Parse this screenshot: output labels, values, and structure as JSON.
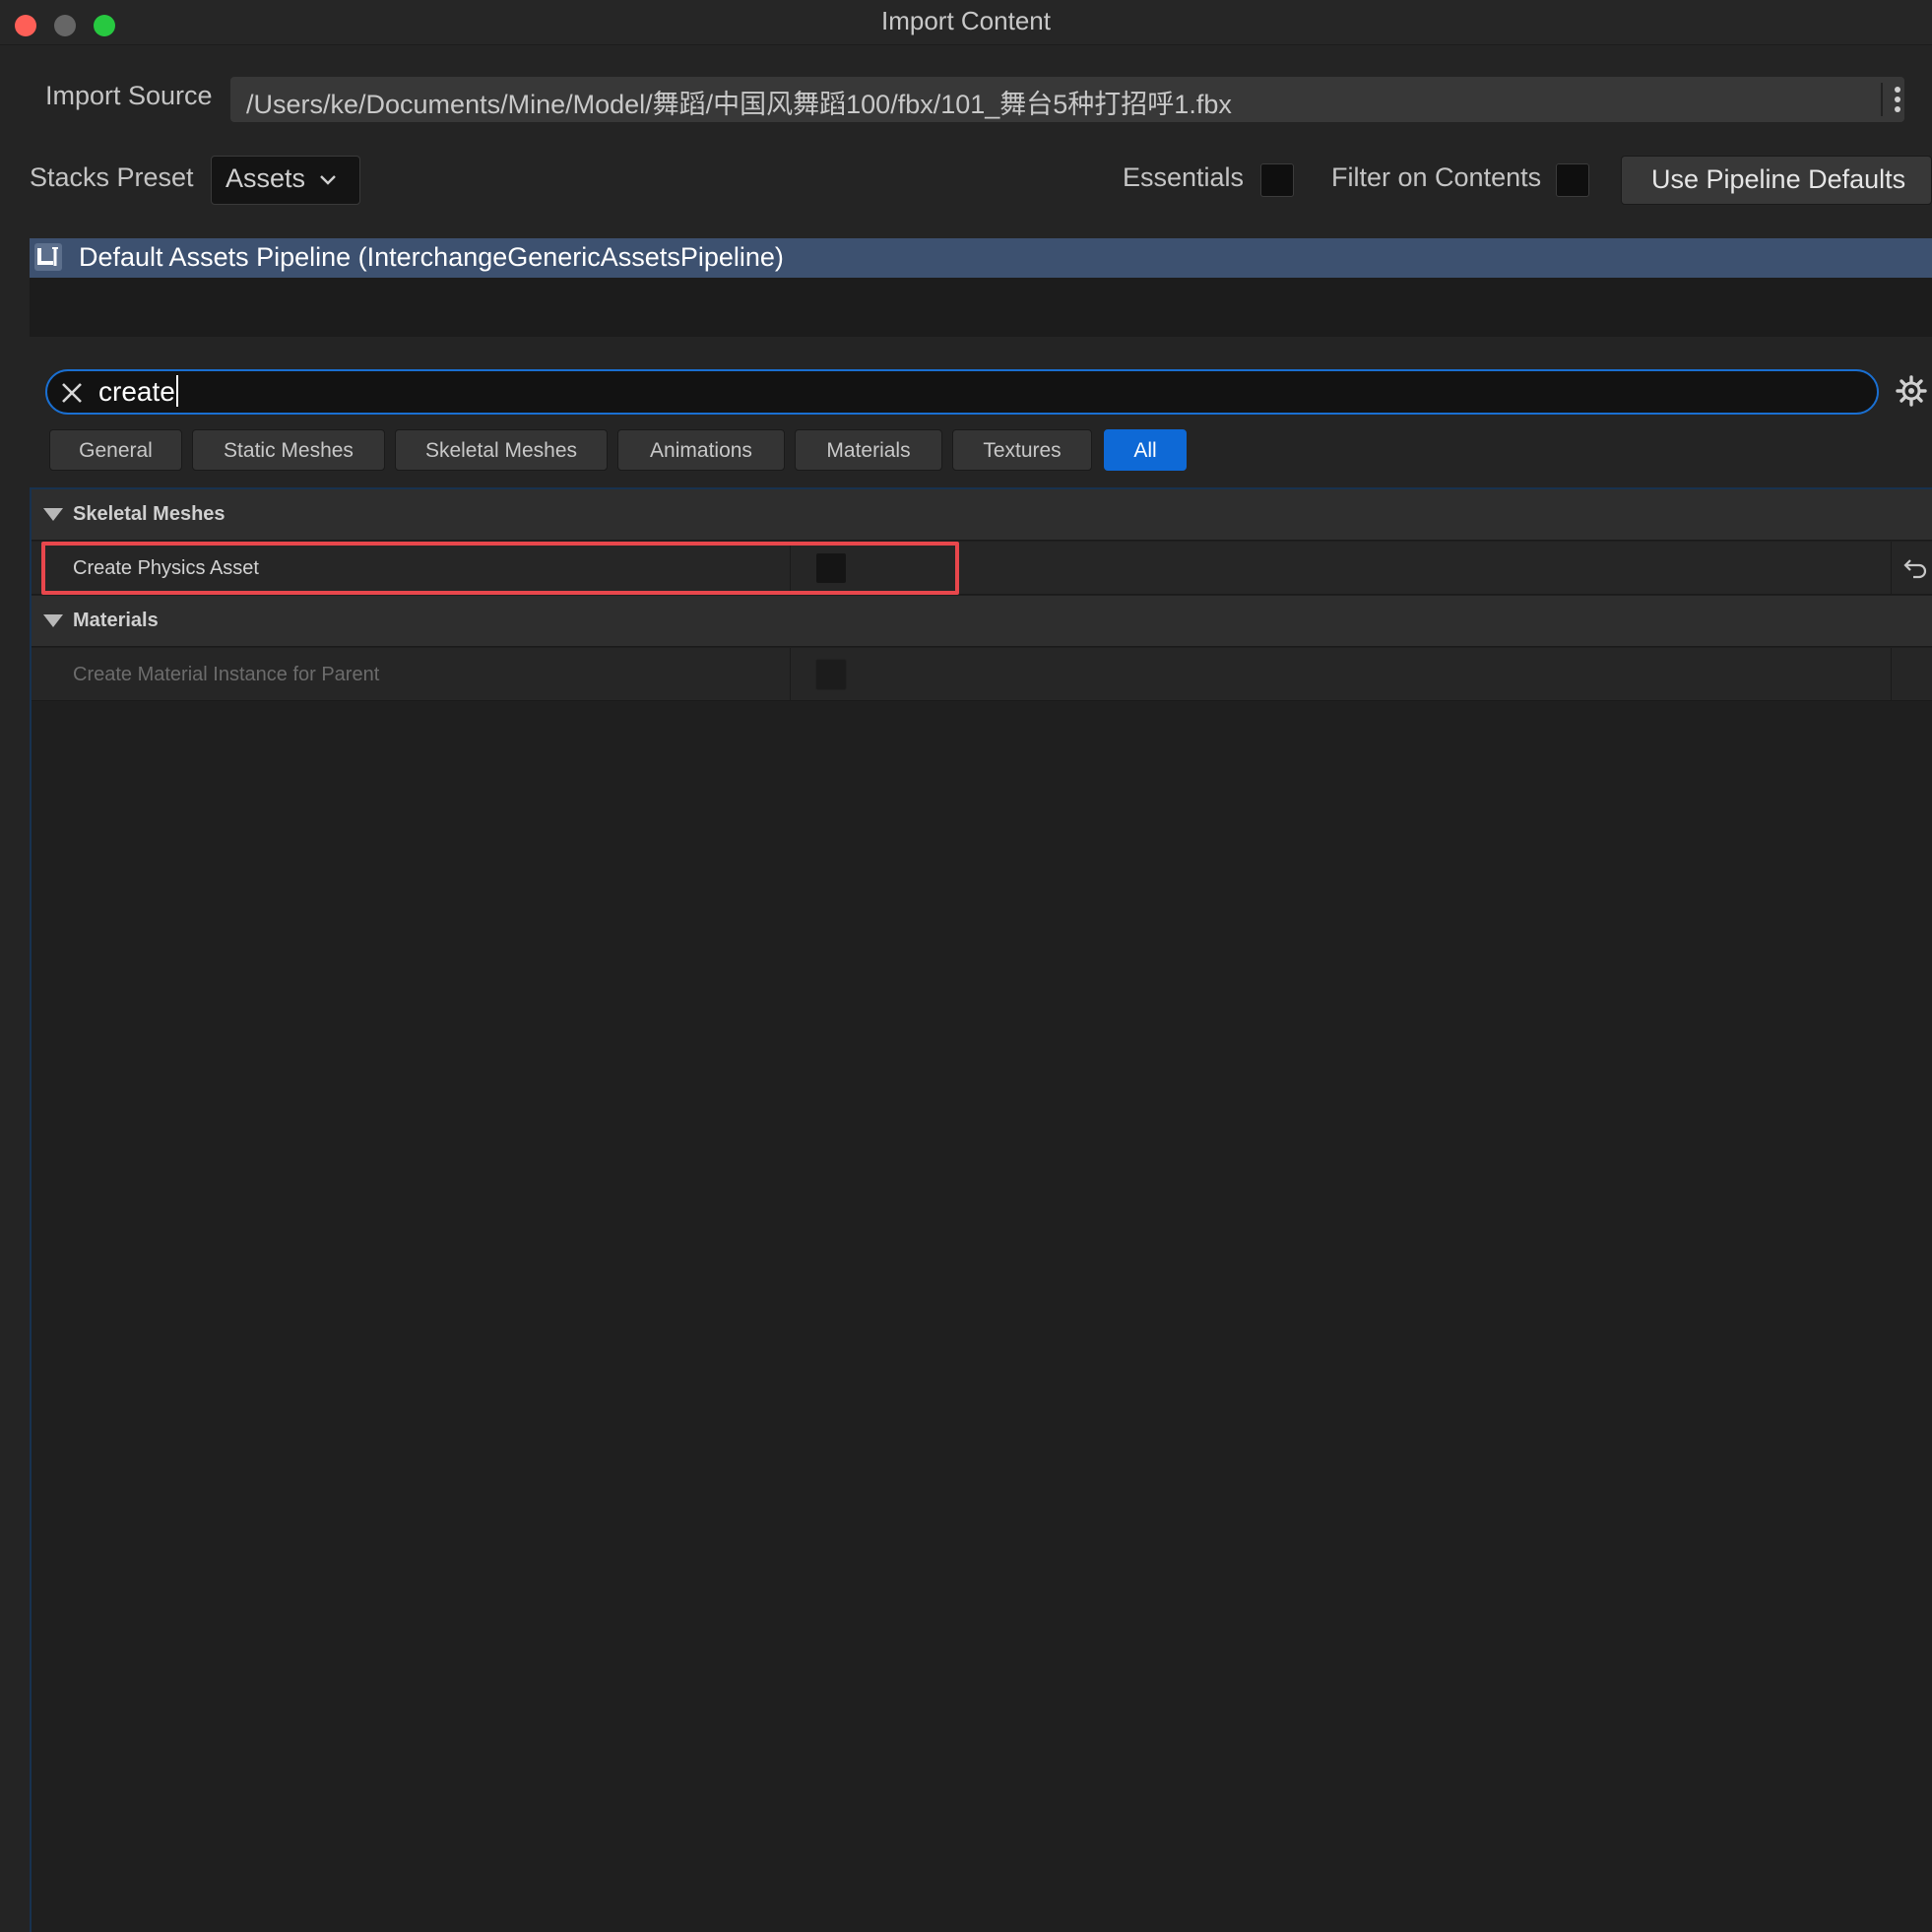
{
  "window": {
    "title": "Import Content"
  },
  "import_source": {
    "label": "Import Source",
    "path": "/Users/ke/Documents/Mine/Model/舞蹈/中国风舞蹈100/fbx/101_舞台5种打招呼1.fbx"
  },
  "toolbar": {
    "stacks_preset_label": "Stacks Preset",
    "stacks_preset_value": "Assets",
    "essentials_label": "Essentials",
    "essentials_checked": false,
    "filter_label": "Filter on Contents",
    "filter_checked": false,
    "defaults_button": "Use Pipeline Defaults"
  },
  "pipeline": {
    "title": "Default Assets Pipeline (InterchangeGenericAssetsPipeline)"
  },
  "search": {
    "query": "create"
  },
  "tabs": [
    {
      "label": "General",
      "active": false
    },
    {
      "label": "Static Meshes",
      "active": false
    },
    {
      "label": "Skeletal Meshes",
      "active": false
    },
    {
      "label": "Animations",
      "active": false
    },
    {
      "label": "Materials",
      "active": false
    },
    {
      "label": "Textures",
      "active": false
    },
    {
      "label": "All",
      "active": true
    }
  ],
  "categories": [
    {
      "title": "Skeletal Meshes",
      "properties": [
        {
          "name": "Create Physics Asset",
          "checked": false,
          "enabled": true,
          "highlighted": true
        }
      ]
    },
    {
      "title": "Materials",
      "properties": [
        {
          "name": "Create Material Instance for Parent",
          "checked": false,
          "enabled": false,
          "highlighted": false
        }
      ]
    }
  ],
  "colors": {
    "accent": "#0e69d6",
    "highlight": "#e8474c",
    "pipeline_header": "#3d5170"
  },
  "icons": [
    "close-icon",
    "gear-icon",
    "chevron-down-icon",
    "kebab-menu-icon",
    "reset-arrow-icon",
    "unreal-logo-icon",
    "triangle-down-icon"
  ]
}
